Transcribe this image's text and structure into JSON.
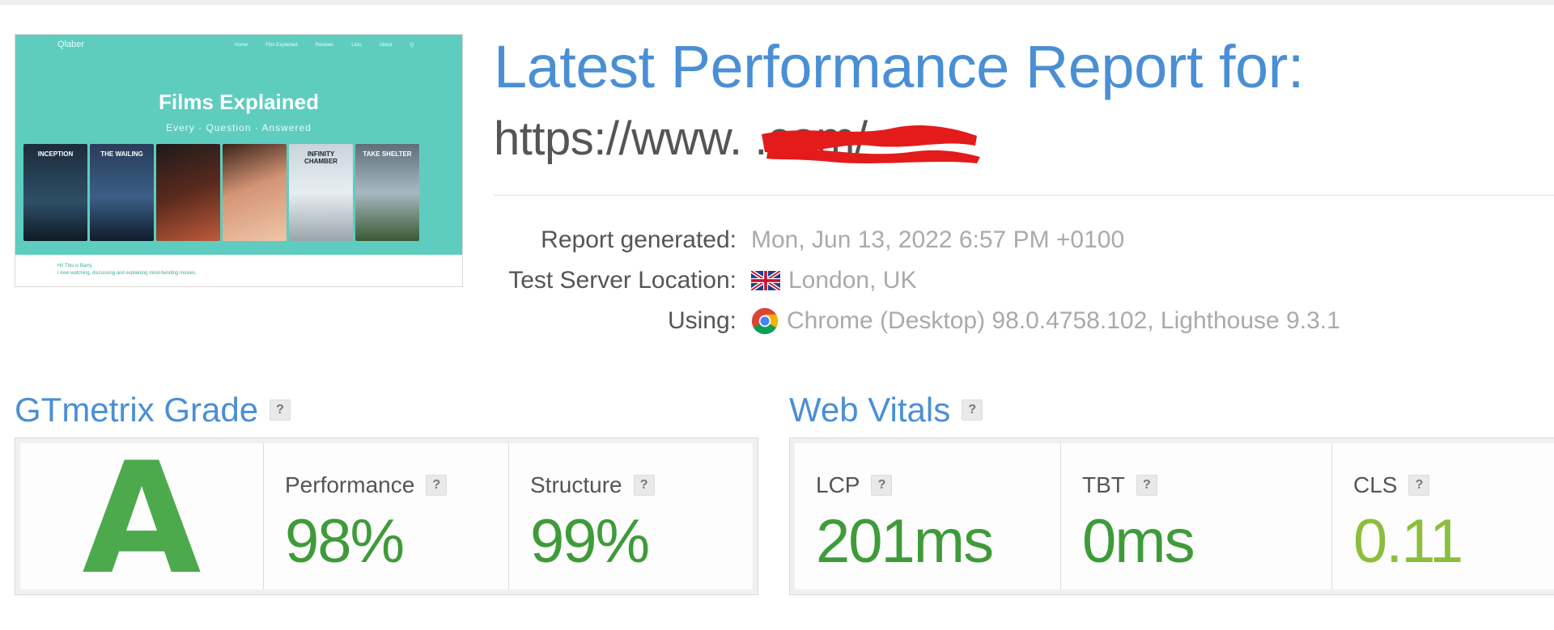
{
  "thumbnail": {
    "logo": "Qlaber",
    "nav": [
      "Home",
      "Film Explained",
      "Reviews",
      "Lists",
      "About",
      "Q"
    ],
    "title": "Films Explained",
    "subtitle": "Every · Question · Answered",
    "posters": [
      "INCEPTION",
      "THE WAILING",
      "",
      "",
      "INFINITY CHAMBER",
      "TAKE SHELTER"
    ],
    "bottom_line1": "Hi! This is Barry.",
    "bottom_line2": "I love watching, discussing and explaining mind-bending movies."
  },
  "header": {
    "title": "Latest Performance Report for:",
    "url": "https://www.                    .com/"
  },
  "meta": {
    "report_generated_label": "Report generated:",
    "report_generated_value": "Mon, Jun 13, 2022 6:57 PM +0100",
    "location_label": "Test Server Location:",
    "location_value": "London, UK",
    "using_label": "Using:",
    "using_value": "Chrome (Desktop) 98.0.4758.102, Lighthouse 9.3.1"
  },
  "grade": {
    "title": "GTmetrix Grade",
    "help": "?",
    "letter": "A",
    "performance_label": "Performance",
    "performance_value": "98%",
    "structure_label": "Structure",
    "structure_value": "99%"
  },
  "vitals": {
    "title": "Web Vitals",
    "help": "?",
    "lcp_label": "LCP",
    "lcp_value": "201ms",
    "tbt_label": "TBT",
    "tbt_value": "0ms",
    "cls_label": "CLS",
    "cls_value": "0.11"
  },
  "colors": {
    "accent_blue": "#4a8fd4",
    "grade_green": "#4caa4c",
    "value_green": "#3f9b3a",
    "cls_green": "#8bbf3b",
    "thumb_teal": "#5ecdbf",
    "redaction_red": "#e31b1b"
  }
}
